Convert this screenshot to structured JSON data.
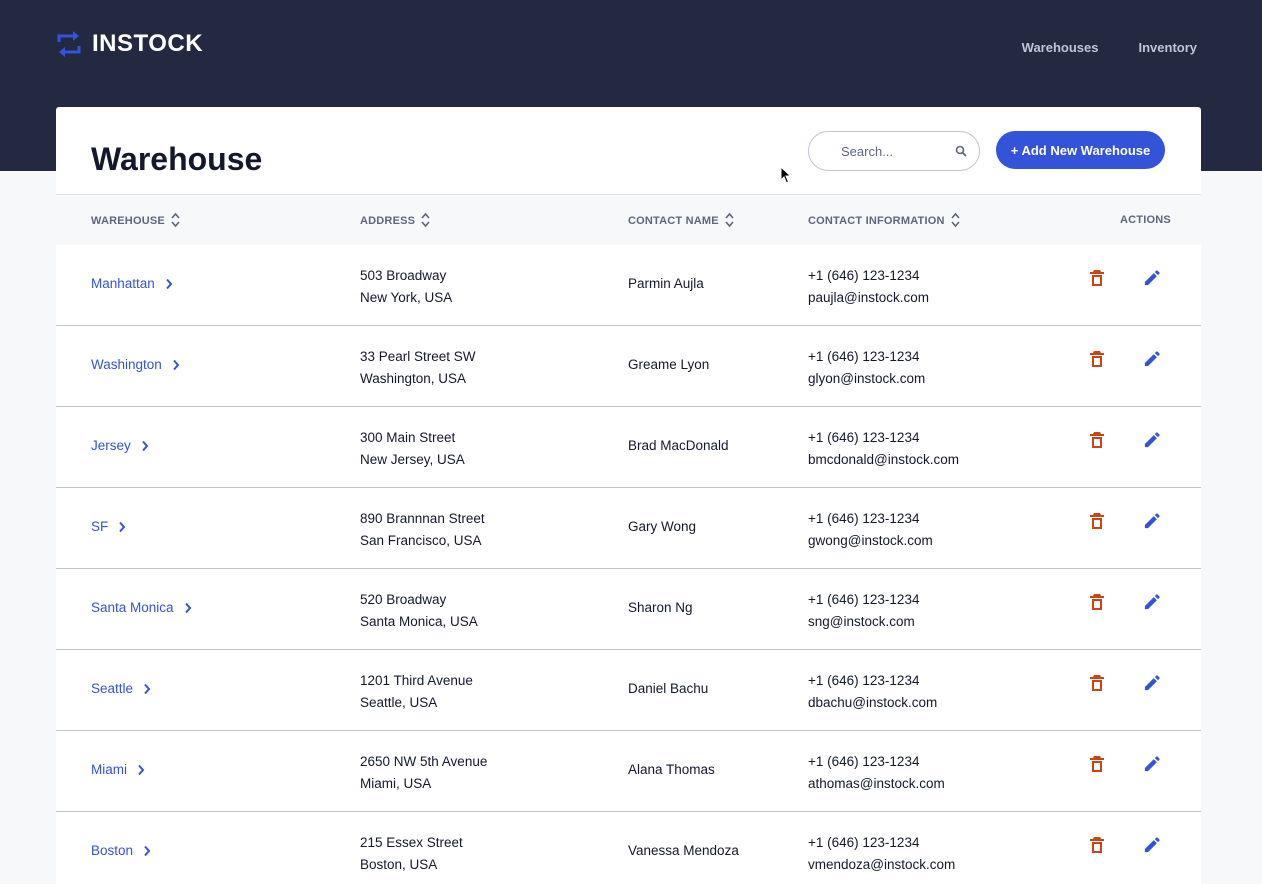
{
  "header": {
    "brand": "INSTOCK",
    "nav": [
      "Warehouses",
      "Inventory"
    ]
  },
  "page": {
    "title": "Warehouse",
    "search_placeholder": "Search...",
    "add_button": "+ Add New Warehouse"
  },
  "table": {
    "columns": [
      "WAREHOUSE",
      "ADDRESS",
      "CONTACT NAME",
      "CONTACT INFORMATION",
      "ACTIONS"
    ],
    "rows": [
      {
        "warehouse": "Manhattan",
        "address1": "503 Broadway",
        "address2": "New York, USA",
        "contact": "Parmin Aujla",
        "phone": "+1 (646) 123-1234",
        "email": "paujla@instock.com"
      },
      {
        "warehouse": "Washington",
        "address1": "33 Pearl Street SW",
        "address2": "Washington, USA",
        "contact": "Greame Lyon",
        "phone": "+1 (646) 123-1234",
        "email": "glyon@instock.com"
      },
      {
        "warehouse": "Jersey",
        "address1": "300 Main Street",
        "address2": "New Jersey, USA",
        "contact": "Brad MacDonald",
        "phone": "+1 (646) 123-1234",
        "email": "bmcdonald@instock.com"
      },
      {
        "warehouse": "SF",
        "address1": "890 Brannnan Street",
        "address2": "San Francisco, USA",
        "contact": "Gary Wong",
        "phone": "+1 (646) 123-1234",
        "email": "gwong@instock.com"
      },
      {
        "warehouse": "Santa Monica",
        "address1": "520 Broadway",
        "address2": "Santa Monica, USA",
        "contact": "Sharon Ng",
        "phone": "+1 (646) 123-1234",
        "email": "sng@instock.com"
      },
      {
        "warehouse": "Seattle",
        "address1": "1201 Third Avenue",
        "address2": "Seattle, USA",
        "contact": "Daniel Bachu",
        "phone": "+1 (646) 123-1234",
        "email": "dbachu@instock.com"
      },
      {
        "warehouse": "Miami",
        "address1": "2650 NW 5th Avenue",
        "address2": "Miami, USA",
        "contact": "Alana Thomas",
        "phone": "+1 (646) 123-1234",
        "email": "athomas@instock.com"
      },
      {
        "warehouse": "Boston",
        "address1": "215 Essex Street",
        "address2": "Boston, USA",
        "contact": "Vanessa Mendoza",
        "phone": "+1 (646) 123-1234",
        "email": "vmendoza@instock.com"
      }
    ]
  },
  "icons": {
    "logo": "swap-arrows-icon",
    "search": "search-icon",
    "sort": "sort-icon",
    "row_link": "chevron-right-icon",
    "delete": "trash-icon",
    "edit": "pencil-icon"
  },
  "colors": {
    "header_bg": "#232940",
    "accent": "#3353d8",
    "delete": "#c94515"
  }
}
